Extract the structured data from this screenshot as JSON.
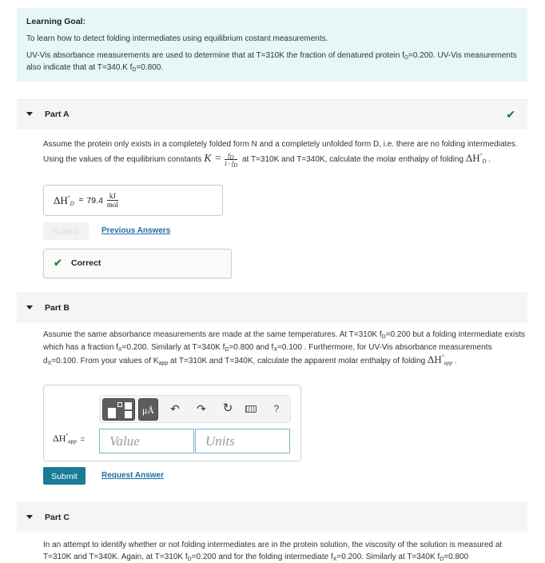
{
  "learning_goal": {
    "title": "Learning Goal:",
    "intro": "To learn how to detect folding intermediates using equilibrium costant measurements.",
    "p2_a": "UV-Vis absorbance measurements are used to determine that at T=310K the fraction of denatured protein f",
    "p2_sub1": "D",
    "p2_b": "=0.200. UV-Vis measurements also indicate that at T=340.K f",
    "p2_sub2": "D",
    "p2_c": "=0.800."
  },
  "part_a": {
    "label": "Part A",
    "status_icon": "checkmark-icon",
    "text_1": "Assume the protein only exists in a completely folded form N and a completely unfolded form D, i.e. there are no folding intermediates. Using the values of the equilibrium constants",
    "eq_k": "K =",
    "frac_num": "f",
    "frac_num_sub": "D",
    "frac_den": "1−f",
    "frac_den_sub": "D",
    "text_2": "at T=310K and T=340K, calculate the molar enthalpy of folding",
    "dh_symbol": "ΔH",
    "dh_sup": "°",
    "dh_sub": "D",
    "text_end": ".",
    "answer": {
      "lhs": "ΔH",
      "lhs_sup": "°",
      "lhs_sub": "D",
      "equals": "=",
      "value": "79.4",
      "unit_num": "kJ",
      "unit_den": "mol"
    },
    "submit_label": "Submit",
    "previous_answers_label": "Previous Answers",
    "feedback": "Correct"
  },
  "part_b": {
    "label": "Part B",
    "t1": "Assume the same absorbance  measurements are made at the same temperatures. At T=310K f",
    "s1": "D",
    "t2": "=0.200 but a folding intermediate exists which has a fraction f",
    "s2": "X",
    "t3": "=0.200. Similarly  at T=340K f",
    "s3": "D",
    "t4": "=0.800 and f",
    "s4": "X",
    "t5": "=0.100 . Furthermore, for UV-Vis absorbance measurements  d",
    "s5": "X",
    "t6": "=0.100. From your values of K",
    "s6": "app",
    "t7": " at T=310K and T=340K, calculate the apparent molar enthalpy of folding",
    "dh_symbol": "ΔH",
    "dh_sup": "°",
    "dh_sub": "app",
    "text_end": ".",
    "toolbar": {
      "templates_icon": "templates-icon",
      "units_label": "μÅ",
      "undo_glyph": "↶",
      "redo_glyph": "↷",
      "reset_glyph": "↻",
      "keyboard_icon": "keyboard-icon",
      "help_glyph": "?"
    },
    "lhs": "ΔH",
    "lhs_sup": "°",
    "lhs_sub": "app",
    "equals": "=",
    "value_placeholder": "Value",
    "units_placeholder": "Units",
    "submit_label": "Submit",
    "request_answer_label": "Request Answer"
  },
  "part_c": {
    "label": "Part C",
    "t1": "In an attempt to identify whether or not folding intermediates are in the protein solution, the viscosity of the solution is measured at T=310K and T=340K. Again, at T=310K f",
    "s1": "D",
    "t2": "=0.200 and for  the folding intermediate  f",
    "s2": "X",
    "t3": "=0.200. Similarly  at T=340K f",
    "s3": "D",
    "t4": "=0.800"
  },
  "colors": {
    "goal_bg": "#e7f6f6",
    "accent": "#1b7a98",
    "link": "#1a6fa0",
    "correct": "#2e8b3a",
    "header_bg": "#f5f5f5"
  }
}
